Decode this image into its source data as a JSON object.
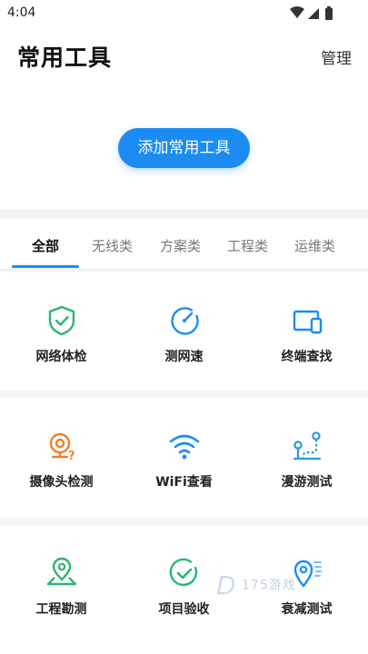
{
  "status_bar": {
    "time": "4:04"
  },
  "header": {
    "title": "常用工具",
    "manage_label": "管理"
  },
  "add_button_label": "添加常用工具",
  "tabs": [
    {
      "label": "全部",
      "active": true
    },
    {
      "label": "无线类",
      "active": false
    },
    {
      "label": "方案类",
      "active": false
    },
    {
      "label": "工程类",
      "active": false
    },
    {
      "label": "运维类",
      "active": false
    }
  ],
  "tools": [
    {
      "label": "网络体检",
      "icon": "shield-check-icon",
      "color": "#2bb673"
    },
    {
      "label": "测网速",
      "icon": "speedometer-icon",
      "color": "#1a8cf2"
    },
    {
      "label": "终端查找",
      "icon": "device-search-icon",
      "color": "#1a8cf2"
    },
    {
      "label": "摄像头检测",
      "icon": "camera-question-icon",
      "color": "#f07f2a"
    },
    {
      "label": "WiFi查看",
      "icon": "wifi-icon",
      "color": "#1a8cf2"
    },
    {
      "label": "漫游测试",
      "icon": "roaming-route-icon",
      "color": "#2a9bd8"
    },
    {
      "label": "工程勘测",
      "icon": "map-pin-icon",
      "color": "#2bb673"
    },
    {
      "label": "项目验收",
      "icon": "check-circle-icon",
      "color": "#2bb673"
    },
    {
      "label": "衰减测试",
      "icon": "signal-pin-icon",
      "color": "#1a8cf2"
    }
  ],
  "colors": {
    "accent": "#1a8cf2",
    "green": "#2bb673",
    "orange": "#f07f2a"
  }
}
